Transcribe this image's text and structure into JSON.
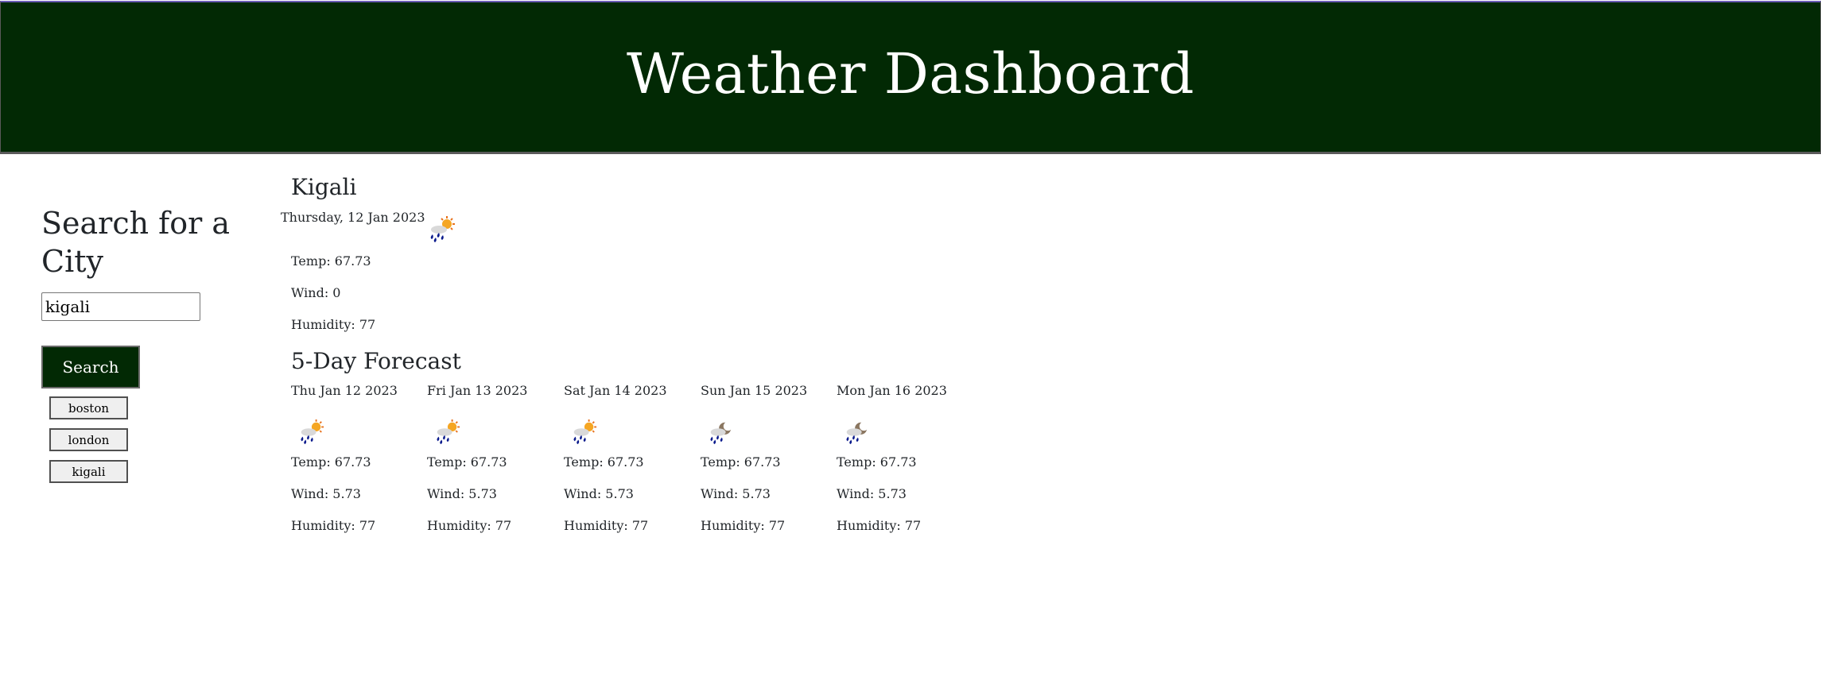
{
  "header": {
    "title": "Weather Dashboard"
  },
  "sidebar": {
    "heading": "Search for a City",
    "search_value": "kigali",
    "search_label": "Search",
    "history": [
      "boston",
      "london",
      "kigali"
    ]
  },
  "current": {
    "city": "Kigali",
    "date": "Thursday, 12 Jan 2023",
    "icon": "rain-sun-icon",
    "temp": "Temp: 67.73",
    "wind": "Wind: 0",
    "humidity": "Humidity: 77"
  },
  "forecast": {
    "title": "5-Day Forecast",
    "days": [
      {
        "date": "Thu Jan 12 2023",
        "icon": "rain-sun-icon",
        "temp": "Temp: 67.73",
        "wind": "Wind: 5.73",
        "humidity": "Humidity: 77"
      },
      {
        "date": "Fri Jan 13 2023",
        "icon": "rain-sun-icon",
        "temp": "Temp: 67.73",
        "wind": "Wind: 5.73",
        "humidity": "Humidity: 77"
      },
      {
        "date": "Sat Jan 14 2023",
        "icon": "rain-sun-icon",
        "temp": "Temp: 67.73",
        "wind": "Wind: 5.73",
        "humidity": "Humidity: 77"
      },
      {
        "date": "Sun Jan 15 2023",
        "icon": "rain-moon-icon",
        "temp": "Temp: 67.73",
        "wind": "Wind: 5.73",
        "humidity": "Humidity: 77"
      },
      {
        "date": "Mon Jan 16 2023",
        "icon": "rain-moon-icon",
        "temp": "Temp: 67.73",
        "wind": "Wind: 5.73",
        "humidity": "Humidity: 77"
      }
    ]
  },
  "colors": {
    "header_bg": "#022904",
    "button_bg": "#022904",
    "text": "#212529"
  }
}
